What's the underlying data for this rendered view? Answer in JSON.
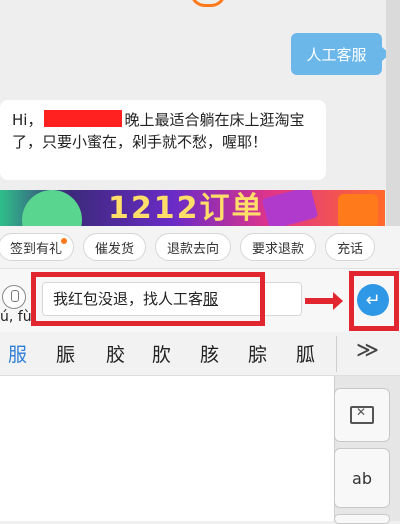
{
  "chat": {
    "outgoing_message": "人工客服",
    "bot_message_prefix": "Hi，",
    "bot_message_body": "晚上最适合躺在床上逛淘宝了，只要小蜜在，剁手就不愁，喔耶！",
    "banner_text": "1212订单"
  },
  "quick_replies": [
    "签到有礼",
    "催发货",
    "退款去向",
    "要求退款",
    "充话"
  ],
  "input": {
    "value": "我红包没退，找人工客",
    "composing": "服",
    "pinyin": "ú, fù",
    "send_icon": "enter-icon"
  },
  "candidates": [
    "服",
    "脤",
    "胶",
    "肷",
    "胲",
    "腙",
    "胍"
  ],
  "candidates_more": "≫",
  "keyboard": {
    "delete_icon": "backspace-icon",
    "ab_label": "ab"
  },
  "colors": {
    "highlight": "#e1262f",
    "send": "#2f98e6",
    "outgoing_bubble": "#6cb7ea"
  }
}
